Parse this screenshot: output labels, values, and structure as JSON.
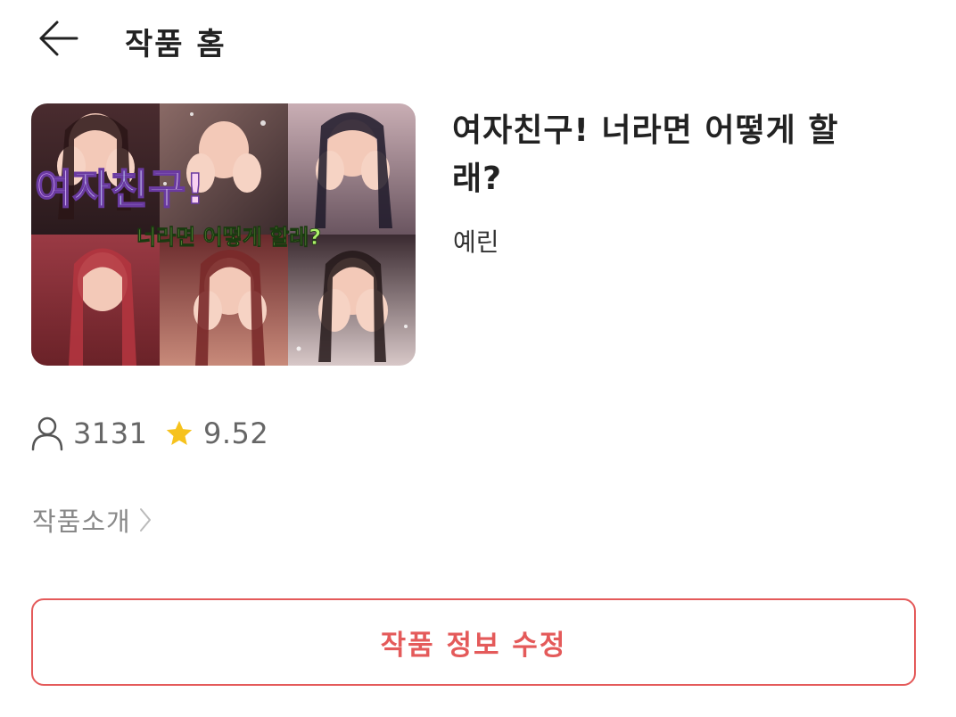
{
  "header": {
    "title": "작품 홈",
    "back_icon": "arrow-left-icon"
  },
  "work": {
    "title": "여자친구! 너라면 어떻게 할래?",
    "author": "예린",
    "cover": {
      "headline": "여자친구!",
      "subline": "너라면 어떻게 할래?"
    }
  },
  "stats": {
    "views": "3131",
    "views_icon": "person-icon",
    "rating": "9.52",
    "rating_icon": "star-icon",
    "star_color": "#f6c21d"
  },
  "intro": {
    "label": "작품소개",
    "icon": "chevron-right-icon"
  },
  "actions": {
    "edit_label": "작품 정보 수정",
    "accent_color": "#e45a5a"
  }
}
